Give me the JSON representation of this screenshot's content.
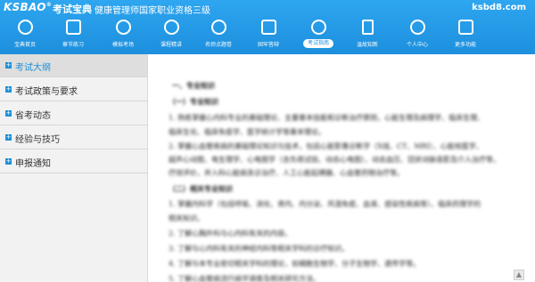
{
  "header": {
    "logo": "KSBAO",
    "logo_mark": "®",
    "app_name": "考试宝典",
    "subtitle": "健康管理师国家职业资格三级",
    "site_url": "ksbd8.com"
  },
  "nav": {
    "items": [
      {
        "label": "宝典首页",
        "icon": "home-icon"
      },
      {
        "label": "章节练习",
        "icon": "book-icon"
      },
      {
        "label": "模拟考场",
        "icon": "clock-icon"
      },
      {
        "label": "课程精讲",
        "icon": "play-icon"
      },
      {
        "label": "名师点题卷",
        "icon": "target-icon"
      },
      {
        "label": "固牢答辩",
        "icon": "group-icon"
      },
      {
        "label": "考试指南",
        "icon": "compass-icon"
      },
      {
        "label": "温故知新",
        "icon": "notes-icon"
      },
      {
        "label": "个人中心",
        "icon": "user-icon"
      },
      {
        "label": "更多功能",
        "icon": "grid-icon"
      }
    ],
    "active_index": 6
  },
  "sidebar": {
    "items": [
      {
        "label": "考试大纲",
        "bullet": "+"
      },
      {
        "label": "考试政策与要求",
        "bullet": "+"
      },
      {
        "label": "省考动态",
        "bullet": "+"
      },
      {
        "label": "经验与技巧",
        "bullet": "+"
      },
      {
        "label": "申报通知",
        "bullet": "+"
      }
    ],
    "active_index": 0
  },
  "content": {
    "lines": [
      "一、专业知识",
      "（一）专业知识",
      "1. 熟练掌握心内科专业的基础理论、主要基本技能和诊断治疗原则，心脏生理及病理学、临床生理、",
      "临床生化、临床免疫学、医学统计学等基本理论。",
      "2. 掌握心血管疾病的基础理论知识与技术，包括心脏影像诊断学（X线、CT、MRI）、心脏核医学、",
      "超声心动图、电生理学、心电图学（含负荷试验、动态心电图）、动态血压、冠状动脉造影及介入治疗等，",
      "疗效评价，并入科心脏病急诊治疗、人工心脏起搏器、心血管药物治疗等。",
      "（二）相关专业知识",
      "1. 掌握内科学（包括呼吸、消化、肾内、内分泌、风湿免疫、血液、感染性疾病等）、临床药理学的",
      "相关知识。",
      "2. 了解心胸外科与心内科有关的内容。",
      "3. 了解与心内科有关的神经内科等相关学科的诊疗知识。",
      "4. 了解与本专业密切相关学科的理论，如细胞生物学、分子生物学、遗传学等。",
      "5. 了解心血管病流行病学调查及相关研究方法。"
    ]
  },
  "scroll_glyph": "▲"
}
